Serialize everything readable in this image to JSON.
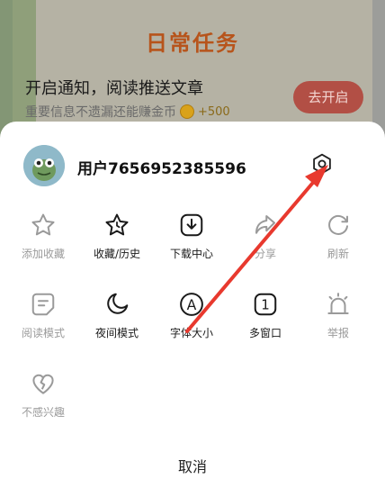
{
  "background": {
    "task_title": "日常任务",
    "task_main": "开启通知，阅读推送文章",
    "task_sub": "重要信息不遗漏还能赚金币",
    "coin_value": "+500",
    "task_button": "去开启"
  },
  "sheet": {
    "username": "用户7656952385596",
    "items_row1": [
      {
        "label": "添加收藏",
        "icon": "star-outline-icon",
        "enabled": false
      },
      {
        "label": "收藏/历史",
        "icon": "star-history-icon",
        "enabled": true
      },
      {
        "label": "下载中心",
        "icon": "download-icon",
        "enabled": true
      },
      {
        "label": "分享",
        "icon": "share-icon",
        "enabled": false
      },
      {
        "label": "刷新",
        "icon": "refresh-icon",
        "enabled": false
      }
    ],
    "items_row2": [
      {
        "label": "阅读模式",
        "icon": "reading-mode-icon",
        "enabled": false
      },
      {
        "label": "夜间模式",
        "icon": "moon-icon",
        "enabled": true
      },
      {
        "label": "字体大小",
        "icon": "font-size-icon",
        "enabled": true
      },
      {
        "label": "多窗口",
        "icon": "multi-window-icon",
        "enabled": true
      },
      {
        "label": "举报",
        "icon": "alarm-icon",
        "enabled": false
      }
    ],
    "items_row3": [
      {
        "label": "不感兴趣",
        "icon": "broken-heart-icon",
        "enabled": false
      }
    ],
    "multi_window_count": "1",
    "font_glyph": "A",
    "cancel": "取消"
  },
  "colors": {
    "accent_red": "#e8392e",
    "disabled_gray": "#9a9a9a"
  }
}
